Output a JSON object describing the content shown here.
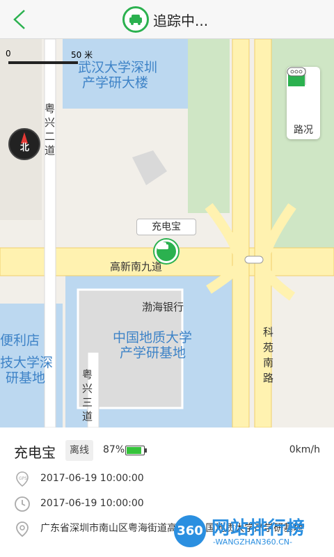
{
  "header": {
    "title": "追踪中...",
    "back_icon": "chevron-left-icon"
  },
  "map": {
    "scale_left": "0",
    "scale_right": "50 米",
    "compass_label": "北",
    "traffic_label": "路况",
    "labels": {
      "building1_line1": "武汉大学深圳",
      "building1_line2": "产学研大楼",
      "road_vertical_left": "粤兴二道",
      "road_horizontal": "高新南九道",
      "bank": "渤海银行",
      "building2_line1": "中国地质大学",
      "building2_line2": "产学研基地",
      "store": "便利店",
      "building3_line1": "技大学深",
      "building3_line2": "研基地",
      "road_vertical_right": "科苑南路",
      "road_vertical_lower": "粤兴三道"
    },
    "marker_label": "充电宝"
  },
  "device": {
    "name": "充电宝",
    "status": "离线",
    "battery_text": "87%",
    "battery_level": 0.87,
    "speed": "0km/h",
    "gps_time": "2017-06-19 10:00:00",
    "record_time": "2017-06-19 10:00:00",
    "address": "广东省深圳市南山区粤海街道高...道中国地质大学产学研基地"
  },
  "watermark": {
    "badge": "360",
    "title": "网站排行榜",
    "subtitle": "-WANGZHAN360.CN-"
  },
  "colors": {
    "accent": "#2bb14f",
    "water": "#bcd8f0",
    "road": "#fff2b0",
    "park": "#cfe6c5"
  }
}
